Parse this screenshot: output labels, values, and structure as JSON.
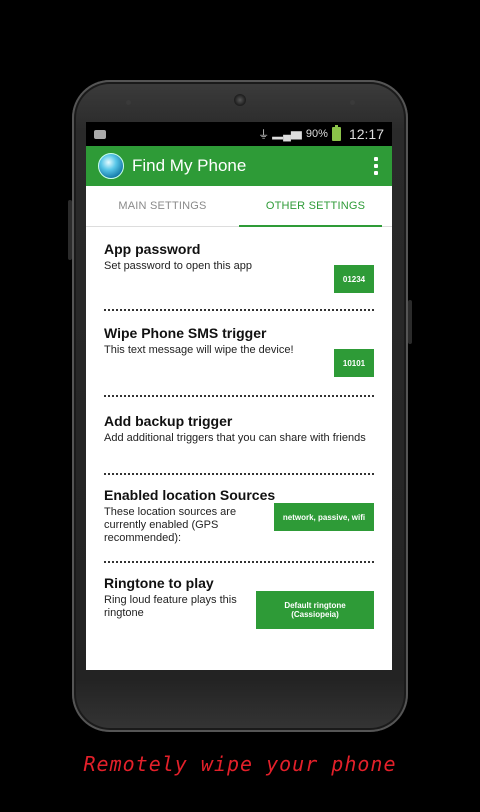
{
  "status_bar": {
    "battery": "90%",
    "time": "12:17"
  },
  "app_bar": {
    "title": "Find My Phone"
  },
  "tabs": [
    {
      "label": "MAIN SETTINGS",
      "active": false
    },
    {
      "label": "OTHER SETTINGS",
      "active": true
    }
  ],
  "settings": [
    {
      "title": "App password",
      "description": "Set password to open this app",
      "value": "01234"
    },
    {
      "title": "Wipe Phone SMS trigger",
      "description": "This text message will wipe the device!",
      "value": "10101"
    },
    {
      "title": "Add backup trigger",
      "description": "Add additional triggers that you can share with friends"
    },
    {
      "title": "Enabled location Sources",
      "description": "These location sources are currently enabled (GPS recommended):",
      "value": "network, passive, wifi"
    },
    {
      "title": "Ringtone to play",
      "description": "Ring loud feature plays this ringtone",
      "value": "Default ringtone (Cassiopeia)"
    }
  ],
  "caption": "Remotely wipe your phone",
  "colors": {
    "accent": "#2e9b37",
    "caption": "#e3202a"
  }
}
